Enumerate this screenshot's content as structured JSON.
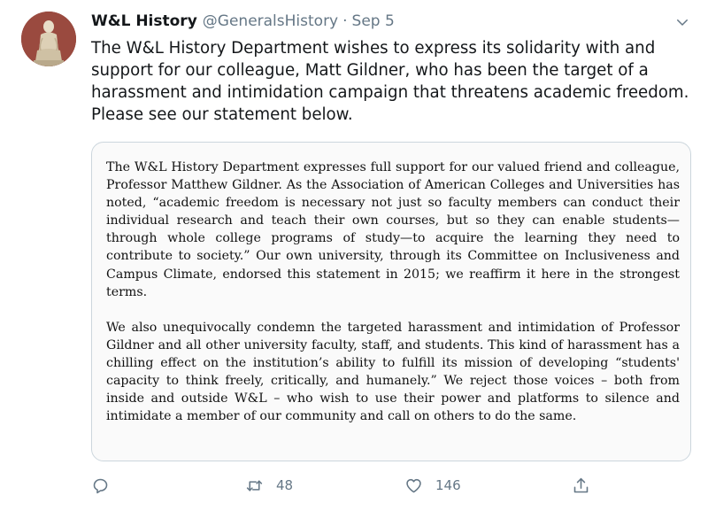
{
  "tweet": {
    "author_name": "W&L History",
    "handle": "@GeneralsHistory",
    "separator": "·",
    "time": "Sep 5",
    "text": "The W&L History Department wishes to express its solidarity with and support for our colleague, Matt Gildner, who has been the target of a harassment and intimidation campaign that threatens academic freedom. Please see our statement below."
  },
  "statement": {
    "paragraph_1": "The W&L History Department expresses full support for our valued friend and colleague, Professor Matthew Gildner. As the Association of American Colleges and Universities has noted, “academic freedom is necessary not just so faculty members can conduct their individual research and teach their own courses, but so they can enable students—through whole college programs of study—to acquire the learning they need to contribute to society.” Our own university, through its Committee on Inclusiveness and Campus Climate, endorsed this statement in 2015; we reaffirm it here in the strongest terms.",
    "paragraph_2": "We also unequivocally condemn the targeted harassment and intimidation of Professor Gildner and all other university faculty, staff, and students. This kind of harassment has a chilling effect on the institution’s ability to fulfill its mission of developing “students' capacity to think freely, critically, and humanely.” We reject those voices – both from inside and outside W&L – who wish to use their power and platforms to silence and intimidate a member of our community and call on others to do the same."
  },
  "actions": {
    "reply_icon": "reply-icon",
    "retweet_icon": "retweet-icon",
    "retweet_count": "48",
    "like_icon": "heart-icon",
    "like_count": "146",
    "share_icon": "share-icon"
  },
  "colors": {
    "text": "#14171a",
    "muted": "#657786",
    "border": "#ccd6dd"
  }
}
